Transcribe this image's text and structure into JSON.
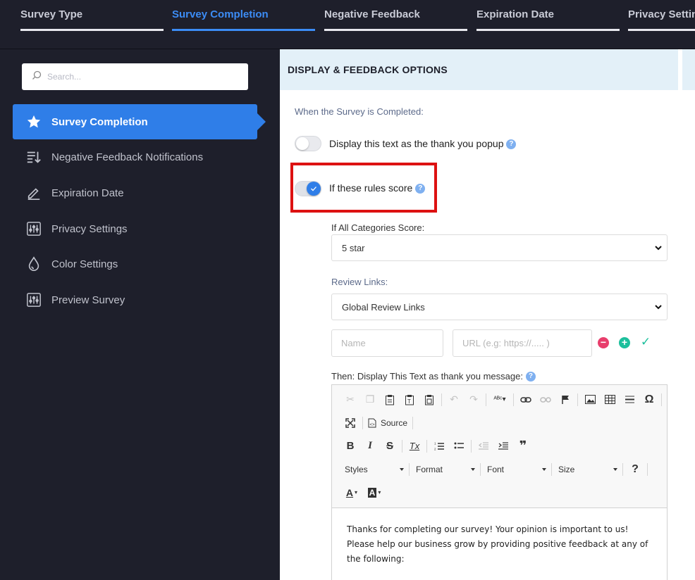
{
  "tabs": [
    {
      "label": "Survey Type",
      "active": false
    },
    {
      "label": "Survey Completion",
      "active": true
    },
    {
      "label": "Negative Feedback",
      "active": false
    },
    {
      "label": "Expiration Date",
      "active": false
    },
    {
      "label": "Privacy Settings",
      "active": false
    }
  ],
  "sidebar": {
    "search_placeholder": "Search...",
    "items": [
      {
        "label": "Survey Completion",
        "icon": "star-icon",
        "active": true
      },
      {
        "label": "Negative Feedback Notifications",
        "icon": "sort-list-icon",
        "active": false
      },
      {
        "label": "Expiration Date",
        "icon": "pencil-icon",
        "active": false
      },
      {
        "label": "Privacy Settings",
        "icon": "sliders-icon",
        "active": false
      },
      {
        "label": "Color Settings",
        "icon": "droplet-icon",
        "active": false
      },
      {
        "label": "Preview Survey",
        "icon": "sliders-icon",
        "active": false
      }
    ]
  },
  "main": {
    "header": "DISPLAY & FEEDBACK OPTIONS",
    "completed_label": "When the Survey is Completed:",
    "option_popup": {
      "label": "Display this text as the thank you popup",
      "checked": false
    },
    "option_rules": {
      "label": "If these rules score",
      "checked": true
    },
    "categories_label": "If All Categories Score:",
    "categories_value": "5 star",
    "review_links_label": "Review Links:",
    "review_links_value": "Global Review Links",
    "name_placeholder": "Name",
    "url_placeholder": "URL (e.g: https://..... )",
    "thank_you_label": "Then: Display This Text as thank you message:",
    "help_glyph": "?",
    "remove_glyph": "−",
    "add_glyph": "+",
    "confirm_glyph": "✓"
  },
  "editor": {
    "source_label": "Source",
    "styles_label": "Styles",
    "format_label": "Format",
    "font_label": "Font",
    "size_label": "Size",
    "bold_glyph": "B",
    "italic_glyph": "I",
    "strike_glyph": "S",
    "removeformat_glyph": "Tx",
    "blockquote_glyph": "❞",
    "omega_glyph": "Ω",
    "help_glyph": "?",
    "text_color_glyph": "A",
    "bg_color_glyph": "A",
    "content": "Thanks for completing our survey! Your opinion is important to us! Please help our business grow by providing positive feedback at any of the following:"
  },
  "colors": {
    "accent": "#2f7ee8",
    "highlight_box": "#dd1111",
    "sidebar_bg": "#1e1f2b",
    "panel_header_bg": "#e3f0f8"
  }
}
